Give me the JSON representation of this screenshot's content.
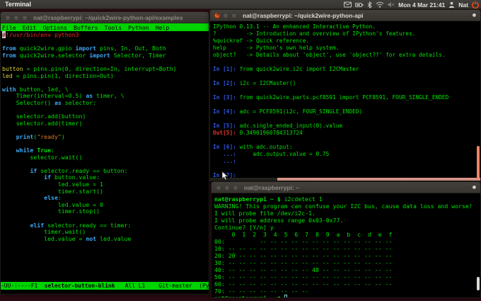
{
  "colors": {
    "desktop": "#2e0b13",
    "panel_gray": "#3c3b37",
    "terminal_green": "#00e202",
    "keyword_blue": "#3fa8f4",
    "ipython_in_blue": "#3056dd",
    "ipython_out_red": "#e2362a",
    "comment_red": "#ef2929",
    "string_orange": "#d8762a",
    "variable_yellow": "#d8d23c",
    "emacs_bar_green": "#00d400",
    "close_button_orange": "#dd4814",
    "scrollbar_orange": "#ee8465"
  },
  "topbar": {
    "app_title": "Terminal",
    "clock": "Mon 4 Mar 21:41",
    "user": "Nat",
    "icons": [
      "mail-icon",
      "battery-icon",
      "bluetooth-icon",
      "wifi-icon",
      "volume-muted-icon",
      "user-icon",
      "power-icon"
    ]
  },
  "left_window": {
    "title": "nat@raspberrypi: ~/quick2wire-python-api/examples",
    "menu_items": [
      "File",
      "Edit",
      "Options",
      "Buffers",
      "Tools",
      "Python",
      "Help"
    ],
    "modeline": {
      "prefix": "-UU-:----F1  ",
      "buffer_name": "selector-button-blink",
      "suffix": "   All L1    Git-master  (Py"
    },
    "code_lines": [
      [
        [
          "c",
          "#"
        ],
        [
          "cm",
          "!/usr/bin/env python3"
        ]
      ],
      [],
      [
        [
          "k",
          "from"
        ],
        [
          "g",
          " quick2wire.gpio "
        ],
        [
          "k",
          "import"
        ],
        [
          "g",
          " pins, In, Out, Both"
        ]
      ],
      [
        [
          "k",
          "from"
        ],
        [
          "g",
          " quick2wire.selector "
        ],
        [
          "k",
          "import"
        ],
        [
          "g",
          " Selector, Timer"
        ]
      ],
      [],
      [
        [
          "y",
          "button"
        ],
        [
          "g",
          " = pins.pin(0, direction=In, interrupt=Both)"
        ]
      ],
      [
        [
          "y",
          "led"
        ],
        [
          "g",
          " = pins.pin(1, direction=Out)"
        ]
      ],
      [],
      [
        [
          "k",
          "with"
        ],
        [
          "g",
          " button, led, \\"
        ]
      ],
      [
        [
          "g",
          "    Timer(interval=0.5) "
        ],
        [
          "k",
          "as"
        ],
        [
          "g",
          " timer, \\"
        ]
      ],
      [
        [
          "g",
          "    Selector() "
        ],
        [
          "k",
          "as"
        ],
        [
          "g",
          " selector:"
        ]
      ],
      [],
      [
        [
          "g",
          "    selector.add(button)"
        ]
      ],
      [
        [
          "g",
          "    selector.add(timer)"
        ]
      ],
      [],
      [
        [
          "g",
          "    "
        ],
        [
          "k",
          "print"
        ],
        [
          "g",
          "("
        ],
        [
          "s",
          "\"ready\""
        ],
        [
          "g",
          ")"
        ]
      ],
      [],
      [
        [
          "g",
          "    "
        ],
        [
          "k",
          "while"
        ],
        [
          "g",
          " "
        ],
        [
          "t",
          "True"
        ],
        [
          "g",
          ":"
        ]
      ],
      [
        [
          "g",
          "        selector.wait()"
        ]
      ],
      [],
      [
        [
          "g",
          "        "
        ],
        [
          "k",
          "if"
        ],
        [
          "g",
          " selector.ready == button:"
        ]
      ],
      [
        [
          "g",
          "            "
        ],
        [
          "k",
          "if"
        ],
        [
          "g",
          " button.value:"
        ]
      ],
      [
        [
          "g",
          "                led.value = 1"
        ]
      ],
      [
        [
          "g",
          "                timer.start()"
        ]
      ],
      [
        [
          "g",
          "            "
        ],
        [
          "k",
          "else"
        ],
        [
          "g",
          ":"
        ]
      ],
      [
        [
          "g",
          "                led.value = 0"
        ]
      ],
      [
        [
          "g",
          "                timer.stop()"
        ]
      ],
      [],
      [
        [
          "g",
          "        "
        ],
        [
          "k",
          "elif"
        ],
        [
          "g",
          " selector.ready == timer:"
        ]
      ],
      [
        [
          "g",
          "            timer.wait()"
        ]
      ],
      [
        [
          "g",
          "            led.value = "
        ],
        [
          "k",
          "not"
        ],
        [
          "g",
          " led.value"
        ]
      ]
    ]
  },
  "ipython_window": {
    "title": "nat@raspberrypi: ~/quick2wire-python-api",
    "lines": [
      [
        [
          "g",
          "IPython 0.13.1 -- An enhanced Interactive Python."
        ]
      ],
      [
        [
          "g",
          "?         -> Introduction and overview of IPython's features."
        ]
      ],
      [
        [
          "g",
          "%quickref -> Quick reference."
        ]
      ],
      [
        [
          "g",
          "help      -> Python's own help system."
        ]
      ],
      [
        [
          "g",
          "object?   -> Details about 'object', use 'object??' for extra details."
        ]
      ],
      [],
      [
        [
          "in",
          "In [1]: "
        ],
        [
          "g",
          "from quick2wire.i2c import I2CMaster"
        ]
      ],
      [],
      [
        [
          "in",
          "In [2]: "
        ],
        [
          "g",
          "i2c = I2CMaster()"
        ]
      ],
      [],
      [
        [
          "in",
          "In [3]: "
        ],
        [
          "g",
          "from quick2wire.parts.pcf8591 import PCF8591, FOUR_SINGLE_ENDED"
        ]
      ],
      [],
      [
        [
          "in",
          "In [4]: "
        ],
        [
          "g",
          "adc = PCF8591(i2c, FOUR_SINGLE_ENDED)"
        ]
      ],
      [],
      [
        [
          "in",
          "In [5]: "
        ],
        [
          "g",
          "adc.single_ended_input(0).value"
        ]
      ],
      [
        [
          "out",
          "Out[5]: "
        ],
        [
          "g",
          "0.34901960784313724"
        ]
      ],
      [],
      [
        [
          "in",
          "In [6]: "
        ],
        [
          "g",
          "with adc.output:"
        ]
      ],
      [
        [
          "in",
          "   ...: "
        ],
        [
          "g",
          "    adc.output.value = 0.75"
        ]
      ],
      [
        [
          "in",
          "   ...: "
        ]
      ],
      [],
      [
        [
          "in",
          "In [7]: "
        ]
      ]
    ]
  },
  "shell_window": {
    "title": "nat@raspberrypi: ~",
    "lines": [
      [
        [
          "p",
          "nat@raspberrypi ~ $"
        ],
        [
          "g",
          " i2cdetect 1"
        ]
      ],
      [
        [
          "g",
          "WARNING! This program can confuse your I2C bus, cause data loss and worse!"
        ]
      ],
      [
        [
          "g",
          "I will probe file /dev/i2c-1."
        ]
      ],
      [
        [
          "g",
          "I will probe address range 0x03-0x77."
        ]
      ],
      [
        [
          "g",
          "Continue? [Y/n] y"
        ]
      ],
      [
        [
          "g",
          "     0  1  2  3  4  5  6  7  8  9  a  b  c  d  e  f"
        ]
      ],
      [
        [
          "g",
          "00:          -- -- -- -- -- -- -- -- -- -- -- -- --"
        ]
      ],
      [
        [
          "g",
          "10: -- -- -- -- -- -- -- -- -- -- -- -- -- -- -- --"
        ]
      ],
      [
        [
          "g",
          "20: 20 -- -- -- -- -- -- -- -- -- -- -- -- -- -- --"
        ]
      ],
      [
        [
          "g",
          "30: -- -- -- -- -- -- -- -- -- -- -- -- -- -- -- --"
        ]
      ],
      [
        [
          "g",
          "40: -- -- -- -- -- -- -- -- 48 -- -- -- -- -- -- --"
        ]
      ],
      [
        [
          "g",
          "50: -- -- -- -- -- -- -- -- -- -- -- -- -- -- -- --"
        ]
      ],
      [
        [
          "g",
          "60: -- -- -- -- -- -- -- -- -- -- -- -- -- -- -- --"
        ]
      ],
      [
        [
          "g",
          "70: -- -- -- -- -- -- -- --"
        ]
      ],
      [
        [
          "p",
          "nat@raspberrypi ~ $ "
        ],
        [
          "cur",
          ""
        ]
      ]
    ]
  }
}
